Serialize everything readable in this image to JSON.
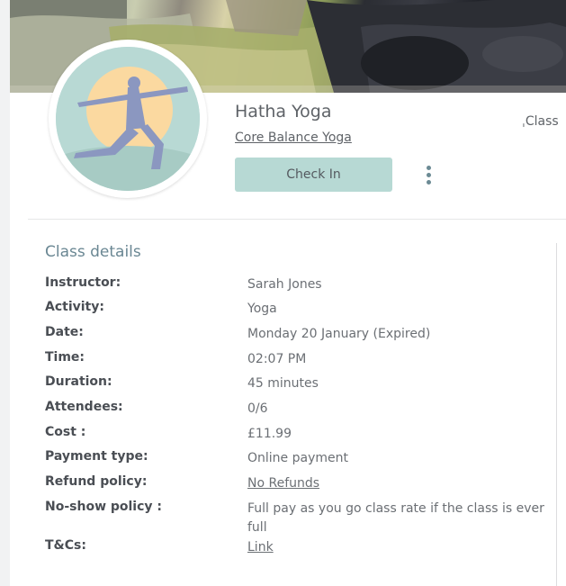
{
  "class": {
    "title": "Hatha Yoga",
    "studio": "Core Balance Yoga",
    "tag": "ˌClass",
    "checkin_label": "Check In"
  },
  "details": {
    "section_title": "Class details",
    "rows": [
      {
        "label": "Instructor:",
        "value": "Sarah Jones"
      },
      {
        "label": "Activity:",
        "value": "Yoga"
      },
      {
        "label": "Date:",
        "value": "Monday 20 January (Expired)"
      },
      {
        "label": "Time:",
        "value": "02:07 PM"
      },
      {
        "label": "Duration:",
        "value": "45 minutes"
      },
      {
        "label": "Attendees:",
        "value": "0/6"
      },
      {
        "label": "Cost :",
        "value": "£11.99"
      },
      {
        "label": "Payment type:",
        "value": "Online payment"
      },
      {
        "label": "Refund policy:",
        "value": "No Refunds"
      },
      {
        "label": "No-show policy :",
        "value": "Full pay as you go class rate if the class is ever full"
      },
      {
        "label": "T&Cs:",
        "value": "Link"
      }
    ]
  },
  "icons": {
    "menu": "kebab-menu-icon",
    "avatar": "yoga-pose-illustration"
  },
  "colors": {
    "accent_button": "#b7d9d4",
    "section_title": "#6a8793",
    "avatar_bg": "#b8d9d4",
    "avatar_sun": "#fbd9a0",
    "avatar_figure": "#8b97c0"
  }
}
